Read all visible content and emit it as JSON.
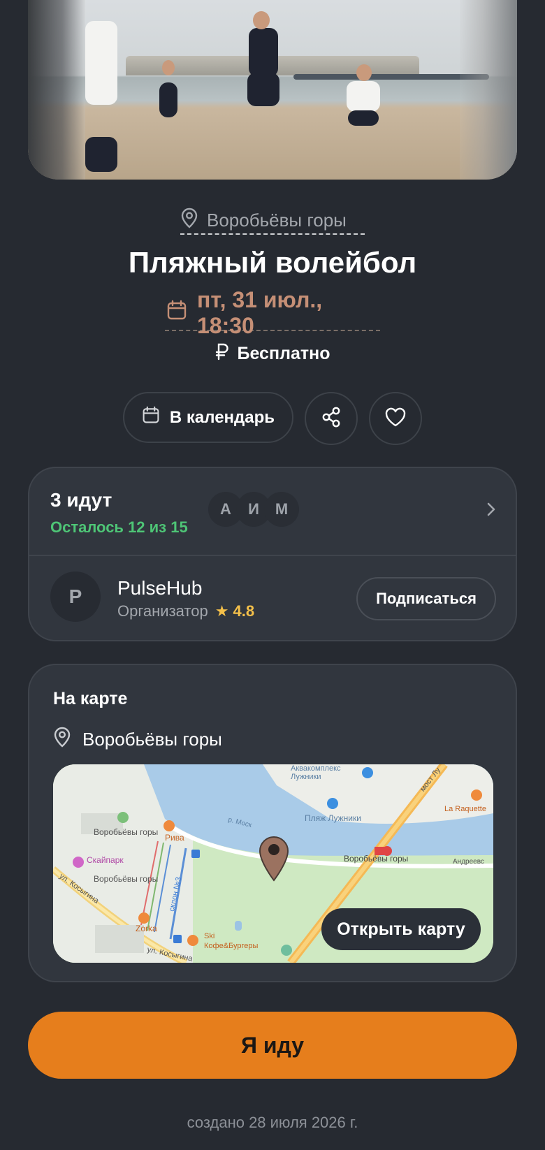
{
  "event": {
    "location": "Воробьёвы горы",
    "title": "Пляжный волейбол",
    "date": "пт, 31 июл., 18:30",
    "price": "Бесплатно"
  },
  "actions": {
    "calendar_label": "В календарь",
    "share_icon": "share-icon",
    "favorite_icon": "heart-icon"
  },
  "participants": {
    "title": "3 идут",
    "remaining": "Осталось 12 из 15",
    "avatars": [
      "А",
      "И",
      "М"
    ]
  },
  "organizer": {
    "initial": "P",
    "name": "PulseHub",
    "role": "Организатор",
    "rating": "★ 4.8",
    "subscribe_label": "Подписаться"
  },
  "map": {
    "title": "На карте",
    "location": "Воробьёвы горы",
    "open_label": "Открыть карту",
    "labels": {
      "aqua": "Аквакомплекс Лужники",
      "beach": "Пляж Лужники",
      "hills_left": "Воробьёвы горы",
      "hills_metro": "Воробьёвы горы",
      "riva": "Рива",
      "skypark": "Скайпарк",
      "hills_stn": "Воробьёвы горы",
      "zorka": "Zorka",
      "ski": "Ski",
      "burgers": "Кофе&Бургеры",
      "laraquette": "La Raquette",
      "bridge": "мост Лу",
      "kosygina": "ул. Косыгина",
      "kosygina2": "ул. Косыгина",
      "slope": "склон №3",
      "river": "р. Моск",
      "andreev": "Андреевс"
    }
  },
  "cta": {
    "label": "Я иду"
  },
  "footer": {
    "created": "создано 28 июля 2026 г."
  },
  "colors": {
    "background": "#262a31",
    "card": "#31363e",
    "accent": "#e67e1c",
    "date": "#c58f76",
    "green": "#4ec576",
    "star": "#f4c04a"
  }
}
